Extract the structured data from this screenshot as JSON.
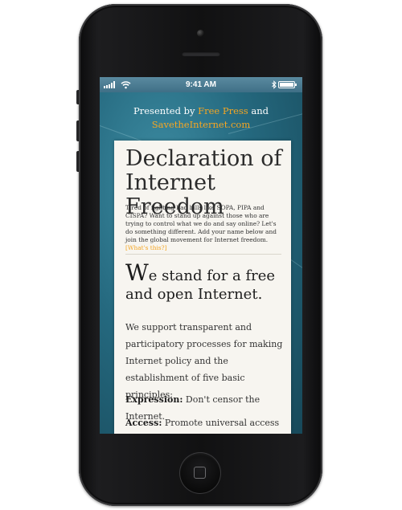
{
  "status_bar": {
    "time": "9:41 AM",
    "battery_level": 1.0
  },
  "header": {
    "presented_prefix": "Presented by",
    "free_press_link": "Free Press",
    "and_text": "and",
    "savetheinternet_link": "SavetheInternet.com"
  },
  "declaration": {
    "title": "Declaration of Internet Freedom",
    "intro": "Tired of fighting bad bills like SOPA, PIPA and CISPA? Want to stand up against those who are trying to control what we do and say online? Let's do something different. Add your name below and join the global movement for Internet freedom.",
    "whats_this_link": "[What's this?]",
    "stand_drop_cap": "W",
    "stand_rest": "e stand for a free and open Internet.",
    "support_text": "We support transparent and participatory processes for making Internet policy and the establishment of five basic principles:",
    "principles": [
      {
        "label": "Expression:",
        "text": "Don't censor the Internet."
      },
      {
        "label": "Access:",
        "text": "Promote universal access to"
      }
    ]
  },
  "colors": {
    "accent_orange": "#f5a623",
    "background_teal": "#25697f",
    "card_bg": "#f7f5f0"
  },
  "icons": [
    "signal-bars-icon",
    "wifi-icon",
    "bluetooth-icon",
    "battery-icon",
    "home-square-icon"
  ]
}
